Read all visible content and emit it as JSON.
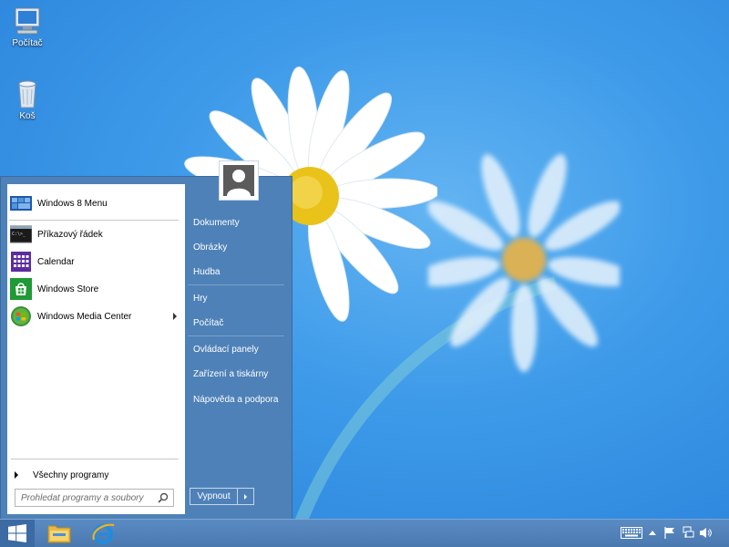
{
  "desktop": {
    "icons": [
      {
        "label": "Počítač",
        "icon": "computer-icon"
      },
      {
        "label": "Koš",
        "icon": "recycle-bin-icon"
      }
    ]
  },
  "start_menu": {
    "pinned": [
      {
        "label": "Windows 8 Menu",
        "icon": "windows8-menu-icon"
      },
      {
        "label": "Příkazový řádek",
        "icon": "command-prompt-icon"
      },
      {
        "label": "Calendar",
        "icon": "calendar-icon"
      },
      {
        "label": "Windows Store",
        "icon": "store-icon"
      },
      {
        "label": "Windows Media Center",
        "icon": "media-center-icon",
        "has_submenu": true
      }
    ],
    "all_programs": "Všechny programy",
    "search_placeholder": "Prohledat programy a soubory",
    "right_links": [
      {
        "label": "Dokumenty"
      },
      {
        "label": "Obrázky"
      },
      {
        "label": "Hudba"
      },
      {
        "label": "Hry"
      },
      {
        "label": "Počítač"
      },
      {
        "label": "Ovládací panely"
      },
      {
        "label": "Zařízení a tiskárny"
      },
      {
        "label": "Nápověda a podpora"
      }
    ],
    "shutdown_label": "Vypnout"
  },
  "taskbar": {
    "pinned": [
      {
        "icon": "file-explorer-icon"
      },
      {
        "icon": "internet-explorer-icon"
      }
    ],
    "tray_icons": [
      "keyboard-icon",
      "show-hidden-icons-arrow",
      "action-center-flag-icon",
      "network-icon",
      "volume-icon"
    ]
  },
  "colors": {
    "menu_blue": "#4e81b8",
    "taskbar_blue": "#4a79b0",
    "desktop_blue": "#3d9ae9"
  }
}
